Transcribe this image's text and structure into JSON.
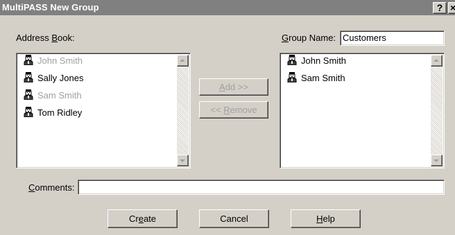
{
  "window": {
    "title": "MultiPASS New Group",
    "help_label": "?",
    "close_label": "×"
  },
  "address_book": {
    "label_prefix": "Address ",
    "label_mnemonic": "B",
    "label_suffix": "ook:",
    "items": [
      {
        "name": "John Smith",
        "enabled": false
      },
      {
        "name": "Sally Jones",
        "enabled": true
      },
      {
        "name": "Sam Smith",
        "enabled": false
      },
      {
        "name": "Tom Ridley",
        "enabled": true
      }
    ]
  },
  "group_name": {
    "label_mnemonic": "G",
    "label_suffix": "roup Name:",
    "value": "Customers"
  },
  "group_members": {
    "items": [
      {
        "name": "John Smith"
      },
      {
        "name": "Sam Smith"
      }
    ]
  },
  "actions": {
    "add_label": "Add >>",
    "add_mnemonic": "A",
    "add_rest": "dd >>",
    "remove_label": "<< Remove",
    "remove_prefix": "<< ",
    "remove_mnemonic": "R",
    "remove_rest": "emove"
  },
  "comments": {
    "label_mnemonic": "C",
    "label_suffix": "omments:",
    "value": ""
  },
  "buttons": {
    "create_prefix": "Cr",
    "create_mnemonic": "e",
    "create_suffix": "ate",
    "cancel": "Cancel",
    "help_mnemonic": "H",
    "help_suffix": "elp"
  }
}
